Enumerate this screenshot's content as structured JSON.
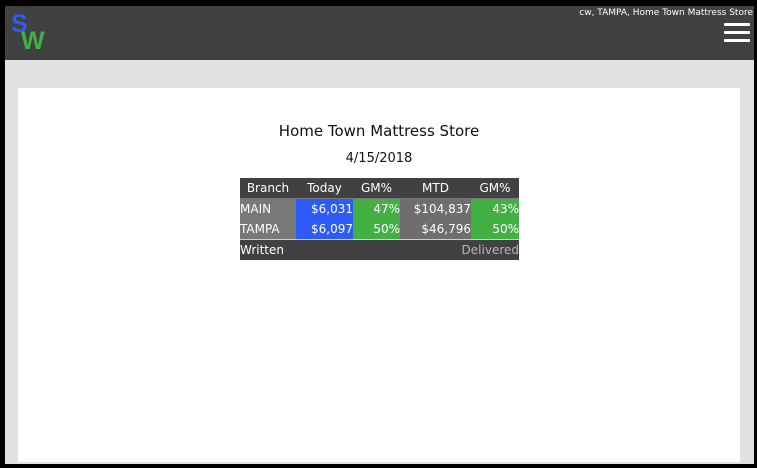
{
  "header": {
    "logo_s": "S",
    "logo_w": "W",
    "user_info": "cw, TAMPA, Home Town Mattress Store"
  },
  "report": {
    "store_name": "Home Town Mattress Store",
    "date": "4/15/2018",
    "columns": [
      "Branch",
      "Today",
      "GM%",
      "MTD",
      "GM%"
    ],
    "rows": [
      {
        "branch": "MAIN",
        "today": "$6,031",
        "today_gm": "47%",
        "mtd": "$104,837",
        "mtd_gm": "43%"
      },
      {
        "branch": "TAMPA",
        "today": "$6,097",
        "today_gm": "50%",
        "mtd": "$46,796",
        "mtd_gm": "50%"
      }
    ],
    "footer": {
      "written": "Written",
      "delivered": "Delivered"
    }
  },
  "colors": {
    "topbar": "#414141",
    "today": "#2c5cf5",
    "gm": "#43b043",
    "branch": "#787878",
    "mtd": "#6e6e6e"
  }
}
